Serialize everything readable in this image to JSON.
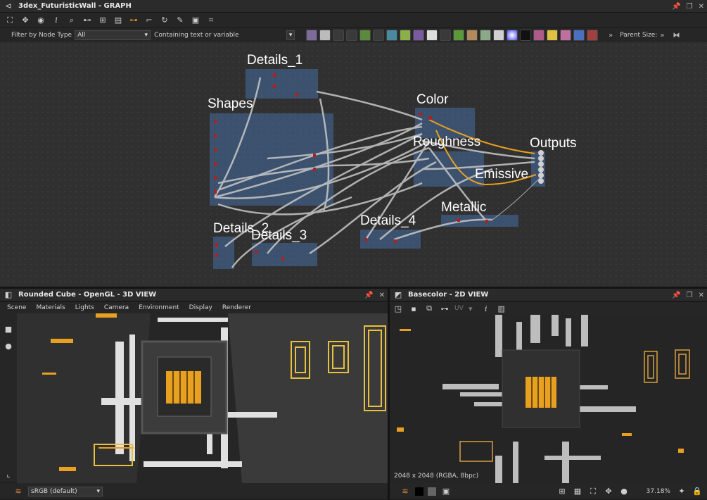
{
  "graph": {
    "title": "3dex_FuturisticWall - GRAPH",
    "filter_label": "Filter by Node Type",
    "filter_value": "All",
    "search_placeholder": "Containing text or variable",
    "parent_size_label": "Parent Size:",
    "frames": [
      "Details_1",
      "Shapes",
      "Color",
      "Roughness",
      "Outputs",
      "Emissive",
      "Metallic",
      "Details_4",
      "Details_2",
      "Details_3"
    ]
  },
  "view3d": {
    "title": "Rounded Cube - OpenGL - 3D VIEW",
    "menu": [
      "Scene",
      "Materials",
      "Lights",
      "Camera",
      "Environment",
      "Display",
      "Renderer"
    ],
    "colorspace": "sRGB (default)"
  },
  "view2d": {
    "title": "Basecolor - 2D VIEW",
    "uv_label": "UV",
    "resolution": "2048 x 2048 (RGBA, 8bpc)",
    "zoom": "37.18%"
  },
  "colors": {
    "accent": "#e8a020",
    "frame": "#4a72a6",
    "bg": "#1e1e1e"
  }
}
